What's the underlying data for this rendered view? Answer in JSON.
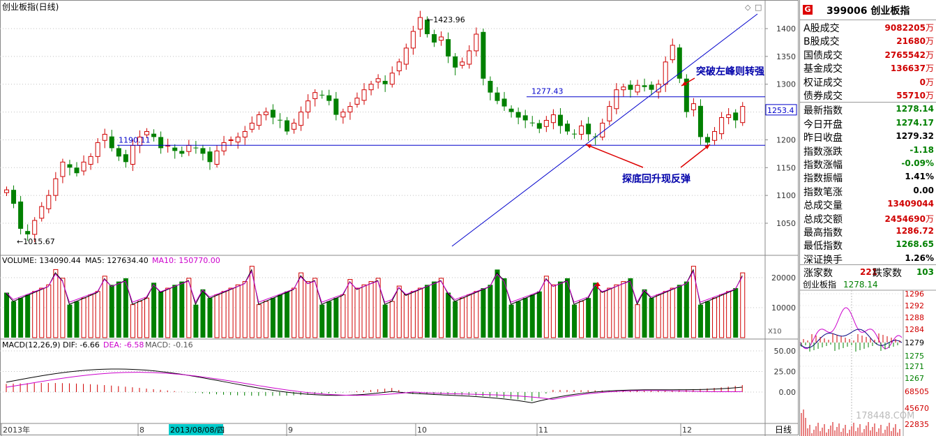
{
  "window": {
    "title": "创业板指(日线)",
    "corner_icons": [
      "diamond-icon",
      "square-icon"
    ]
  },
  "price_panel": {
    "y_ticks": [
      "1400",
      "1350",
      "1300",
      "1250",
      "1200",
      "1150",
      "1100",
      "1050"
    ],
    "current_price_tag": "1253.4",
    "labels": {
      "high": "1423.96",
      "low": "1015.67",
      "support": "1190.11",
      "resistance": "1277.43"
    },
    "annotations": {
      "breakout": "突破左峰则转强",
      "rebound": "探底回升现反弹"
    }
  },
  "volume_panel": {
    "legend": {
      "volume": "VOLUME: 134090.44",
      "ma5": "MA5: 127634.40",
      "ma10": "MA10: 150770.00"
    },
    "y_ticks": [
      "20000",
      "10000"
    ],
    "multiplier": "X10"
  },
  "macd_panel": {
    "legend": {
      "name": "MACD(12,26,9)",
      "dif": "DIF: -6.66",
      "dea": "DEA: -6.58",
      "macd": "MACD: -0.16"
    },
    "y_ticks": [
      "50.00",
      "25.00",
      "0.00"
    ]
  },
  "time_axis": {
    "labels": [
      "2013年",
      "8",
      "9",
      "10",
      "11",
      "12"
    ],
    "cursor_date": "2013/08/08/四",
    "period": "日线"
  },
  "sidebar": {
    "code": "399006",
    "name": "创业板指",
    "rows_top": [
      {
        "label": "A股成交",
        "value": "9082205",
        "unit": "万"
      },
      {
        "label": "B股成交",
        "value": "21680",
        "unit": "万"
      },
      {
        "label": "国债成交",
        "value": "2765542",
        "unit": "万"
      },
      {
        "label": "基金成交",
        "value": "136637",
        "unit": "万"
      },
      {
        "label": "权证成交",
        "value": "0",
        "unit": "万"
      },
      {
        "label": "债券成交",
        "value": "55710",
        "unit": "万"
      }
    ],
    "rows_index": [
      {
        "label": "最新指数",
        "value": "1278.14",
        "cls": "green"
      },
      {
        "label": "今日开盘",
        "value": "1274.17",
        "cls": "green"
      },
      {
        "label": "昨日收盘",
        "value": "1279.32",
        "cls": "blk"
      },
      {
        "label": "指数涨跌",
        "value": "-1.18",
        "cls": "green"
      },
      {
        "label": "指数涨幅",
        "value": "-0.09%",
        "cls": "green"
      },
      {
        "label": "指数振幅",
        "value": "1.41%",
        "cls": "blk"
      },
      {
        "label": "指数笔涨",
        "value": "0.00",
        "cls": "blk"
      },
      {
        "label": "总成交量",
        "value": "13409044",
        "cls": "red"
      },
      {
        "label": "总成交额",
        "value": "2454690",
        "unit": "万",
        "cls": "red"
      },
      {
        "label": "最高指数",
        "value": "1286.72",
        "cls": "red"
      },
      {
        "label": "最低指数",
        "value": "1268.65",
        "cls": "green"
      },
      {
        "label": "深证换手",
        "value": "1.26%",
        "cls": "blk"
      }
    ],
    "updown": {
      "up_label": "涨家数",
      "up_value": "221",
      "down_label": "跌家数",
      "down_value": "103"
    },
    "mini_chart": {
      "title": "创业板指",
      "price": "1278.14",
      "price_ticks": [
        "1296",
        "1292",
        "1288",
        "1284",
        "1279",
        "1275",
        "1271",
        "1267"
      ],
      "vol_ticks": [
        "68505",
        "45670",
        "22835"
      ],
      "watermark": "178448.COM"
    }
  },
  "colors": {
    "up": "#d00000",
    "down": "#008000",
    "ma5": "#000000",
    "ma10": "#cc00cc",
    "line": "#0000cc",
    "grid": "#c0c0c0"
  }
}
